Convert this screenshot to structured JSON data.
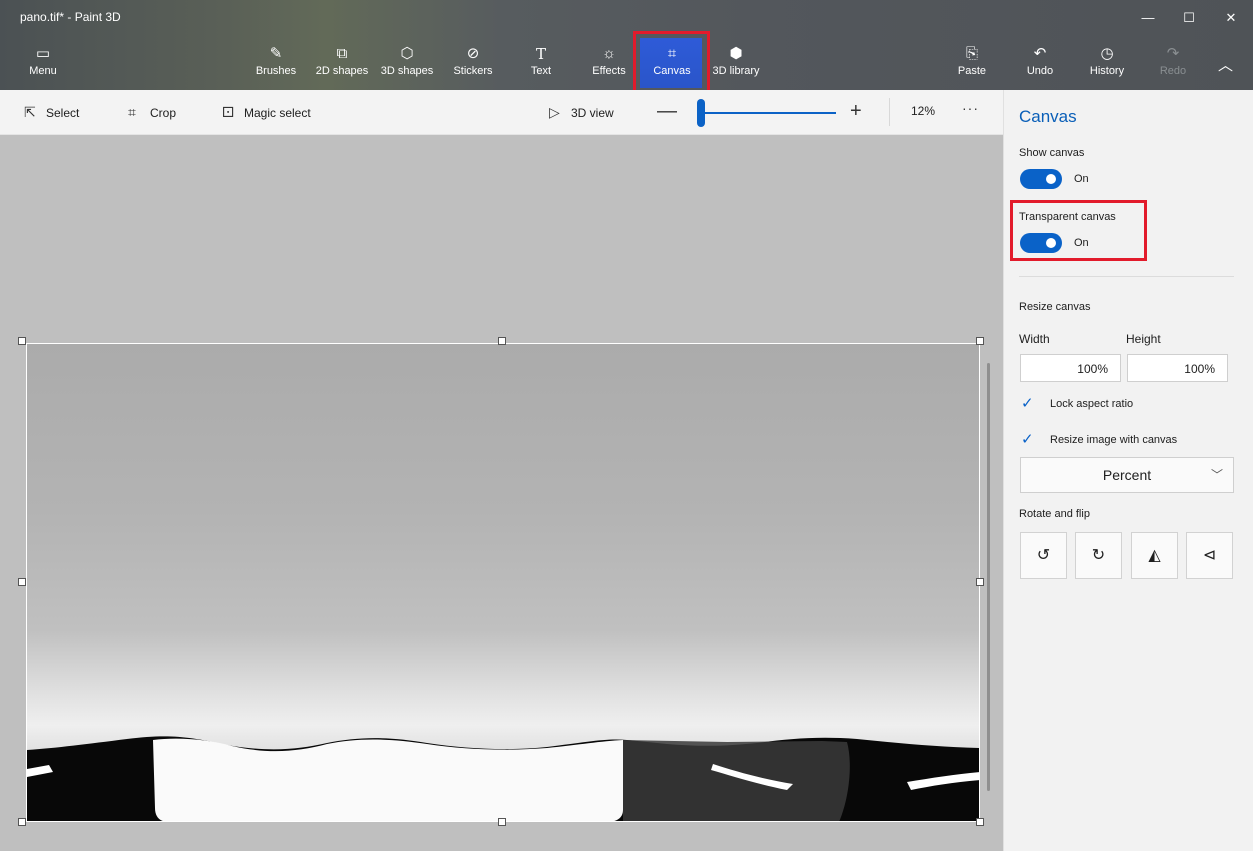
{
  "window": {
    "title": "pano.tif* - Paint 3D",
    "minimize_glyph": "—",
    "maximize_glyph": "☐",
    "close_glyph": "✕"
  },
  "ribbon": {
    "menu": {
      "label": "Menu",
      "icon": "folder-icon"
    },
    "tools": [
      {
        "label": "Brushes",
        "icon": "brush-icon"
      },
      {
        "label": "2D shapes",
        "icon": "shapes-2d-icon"
      },
      {
        "label": "3D shapes",
        "icon": "cube-icon"
      },
      {
        "label": "Stickers",
        "icon": "sticker-icon"
      },
      {
        "label": "Text",
        "icon": "text-icon"
      },
      {
        "label": "Effects",
        "icon": "sun-icon"
      },
      {
        "label": "Canvas",
        "icon": "canvas-icon",
        "selected": true
      },
      {
        "label": "3D library",
        "icon": "library-icon"
      }
    ],
    "paste": {
      "label": "Paste",
      "icon": "paste-icon"
    },
    "undo": {
      "label": "Undo",
      "icon": "undo-icon"
    },
    "history": {
      "label": "History",
      "icon": "history-icon"
    },
    "redo": {
      "label": "Redo",
      "icon": "redo-icon",
      "disabled": true
    },
    "collapse_icon": "chevron-up-icon"
  },
  "toolbar": {
    "select": "Select",
    "crop": "Crop",
    "magic_select": "Magic select",
    "view_3d": "3D view",
    "zoom_minus": "—",
    "zoom_plus": "+",
    "zoom_level": "12%",
    "more": "···"
  },
  "panel": {
    "title": "Canvas",
    "show_canvas": {
      "label": "Show canvas",
      "state": "On"
    },
    "transparent_canvas": {
      "label": "Transparent canvas",
      "state": "On"
    },
    "resize_canvas": "Resize canvas",
    "width_label": "Width",
    "height_label": "Height",
    "width_value": "100%",
    "height_value": "100%",
    "lock_aspect_ratio": "Lock aspect ratio",
    "resize_image_with_canvas": "Resize image with canvas",
    "unit": "Percent",
    "rotate_and_flip": "Rotate and flip"
  },
  "colors": {
    "accent": "#0a62c8",
    "highlight_box": "#e21b2b"
  }
}
